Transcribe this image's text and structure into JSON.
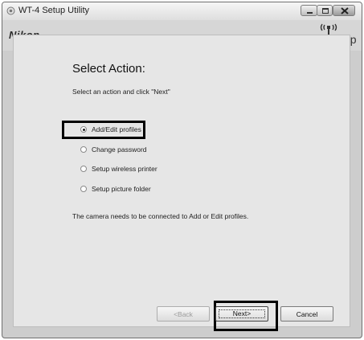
{
  "window": {
    "title": "WT-4 Setup Utility",
    "controls": [
      "minimize-icon",
      "maximize-icon",
      "close-icon"
    ]
  },
  "header": {
    "brand": "Nikon.",
    "setup_label": "Setup"
  },
  "content": {
    "heading": "Select Action:",
    "instruction": "Select an action and click \"Next\"",
    "options": [
      {
        "label": "Add/Edit profiles",
        "selected": true
      },
      {
        "label": "Change password",
        "selected": false
      },
      {
        "label": "Setup wireless printer",
        "selected": false
      },
      {
        "label": "Setup picture folder",
        "selected": false
      }
    ],
    "note": "The camera needs to be connected to Add or Edit profiles."
  },
  "buttons": {
    "back_label": "<Back",
    "next_label": "Next>",
    "cancel_label": "Cancel",
    "back_enabled": false
  },
  "colors": {
    "window_bg": "#cdcdcd",
    "panel_bg": "#e6e6e6",
    "highlight": "#000000"
  }
}
